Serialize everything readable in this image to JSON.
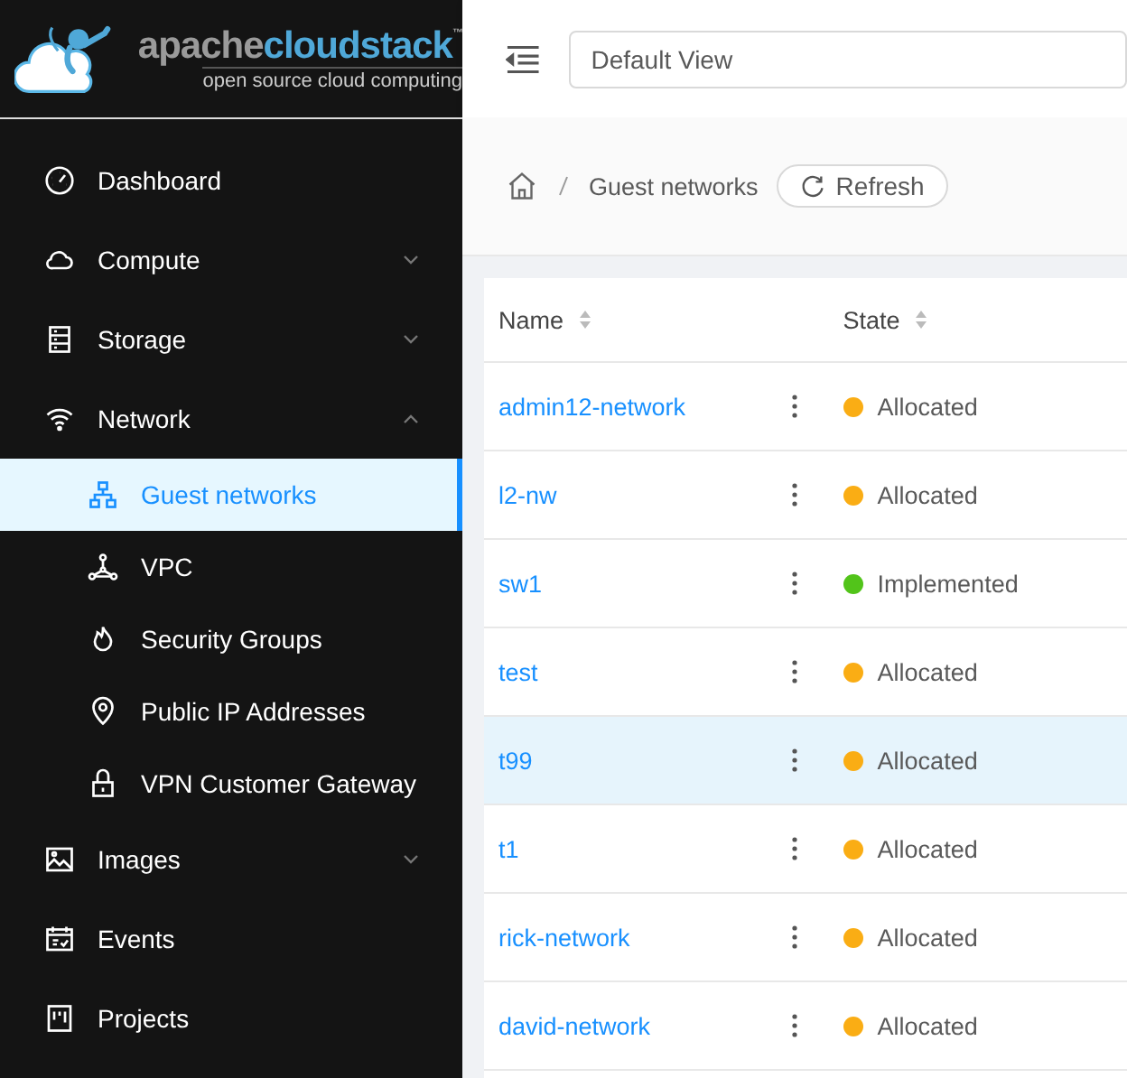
{
  "logo": {
    "word_1": "apache",
    "word_2": "cloudstack",
    "mark": "™",
    "tagline": "open source cloud computing"
  },
  "header": {
    "view_selector": {
      "value": "Default View"
    }
  },
  "sidebar": {
    "items": [
      {
        "label": "Dashboard"
      },
      {
        "label": "Compute",
        "expanded": false
      },
      {
        "label": "Storage",
        "expanded": false
      },
      {
        "label": "Network",
        "expanded": true,
        "children": [
          {
            "label": "Guest networks",
            "selected": true
          },
          {
            "label": "VPC",
            "selected": false
          },
          {
            "label": "Security Groups",
            "selected": false
          },
          {
            "label": "Public IP Addresses",
            "selected": false
          },
          {
            "label": "VPN Customer Gateway",
            "selected": false
          }
        ]
      },
      {
        "label": "Images",
        "expanded": false
      },
      {
        "label": "Events"
      },
      {
        "label": "Projects"
      }
    ]
  },
  "breadcrumb": {
    "current": "Guest networks",
    "refresh_button": "Refresh"
  },
  "table": {
    "columns": [
      "Name",
      "State"
    ],
    "rows": [
      {
        "name": "admin12-network",
        "state": "Allocated",
        "color": "#faad14",
        "selected": false
      },
      {
        "name": "l2-nw",
        "state": "Allocated",
        "color": "#faad14",
        "selected": false
      },
      {
        "name": "sw1",
        "state": "Implemented",
        "color": "#52c41a",
        "selected": false
      },
      {
        "name": "test",
        "state": "Allocated",
        "color": "#faad14",
        "selected": false
      },
      {
        "name": "t99",
        "state": "Allocated",
        "color": "#faad14",
        "selected": true
      },
      {
        "name": "t1",
        "state": "Allocated",
        "color": "#faad14",
        "selected": false
      },
      {
        "name": "rick-network",
        "state": "Allocated",
        "color": "#faad14",
        "selected": false
      },
      {
        "name": "david-network",
        "state": "Allocated",
        "color": "#faad14",
        "selected": false
      }
    ]
  }
}
